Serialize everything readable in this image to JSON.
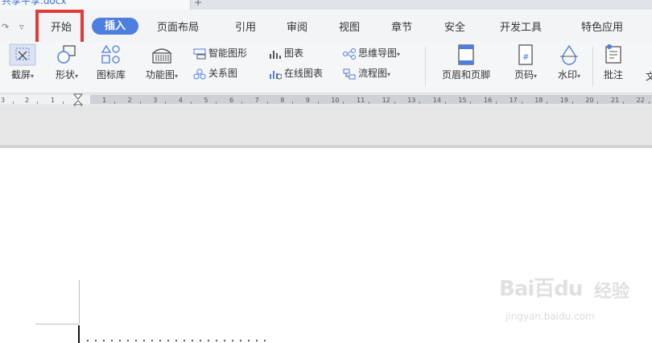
{
  "document": {
    "tab_title": "共享平享.docx",
    "close_glyph": "×",
    "new_tab_glyph": "+"
  },
  "quick_access": {
    "redo_glyph": "↷",
    "dropdown_glyph": "▿"
  },
  "ribbon_tabs": [
    {
      "label": "开始",
      "highlighted": true
    },
    {
      "label": "插入",
      "active": true
    },
    {
      "label": "页面布局"
    },
    {
      "label": "引用"
    },
    {
      "label": "审阅"
    },
    {
      "label": "视图"
    },
    {
      "label": "章节"
    },
    {
      "label": "安全"
    },
    {
      "label": "开发工具"
    },
    {
      "label": "特色应用"
    }
  ],
  "tools": {
    "screenshot": "截屏",
    "shapes": "形状",
    "icon_library": "图标库",
    "function_chart": "功能图",
    "smart_graphic": "智能图形",
    "chart": "图表",
    "mind_map": "思维导图",
    "relation_chart": "关系图",
    "online_chart": "在线图表",
    "flow_chart": "流程图",
    "header_footer": "页眉和页脚",
    "page_number": "页码",
    "watermark": "水印",
    "comment": "批注",
    "text_box_partial": "文"
  },
  "ruler": {
    "ticks": [
      "3",
      "2",
      "1",
      "1",
      "2",
      "3",
      "4",
      "5",
      "6",
      "7",
      "8",
      "9",
      "10",
      "11",
      "12",
      "13",
      "14",
      "15",
      "16",
      "17",
      "18",
      "19",
      "20",
      "21",
      "22"
    ]
  },
  "watermark": {
    "logo": "Bai百du",
    "brand_cn": "经验",
    "url": "jingyan.baidu.com"
  },
  "colors": {
    "accent": "#4d7fe0",
    "highlight": "#e23a3a"
  }
}
